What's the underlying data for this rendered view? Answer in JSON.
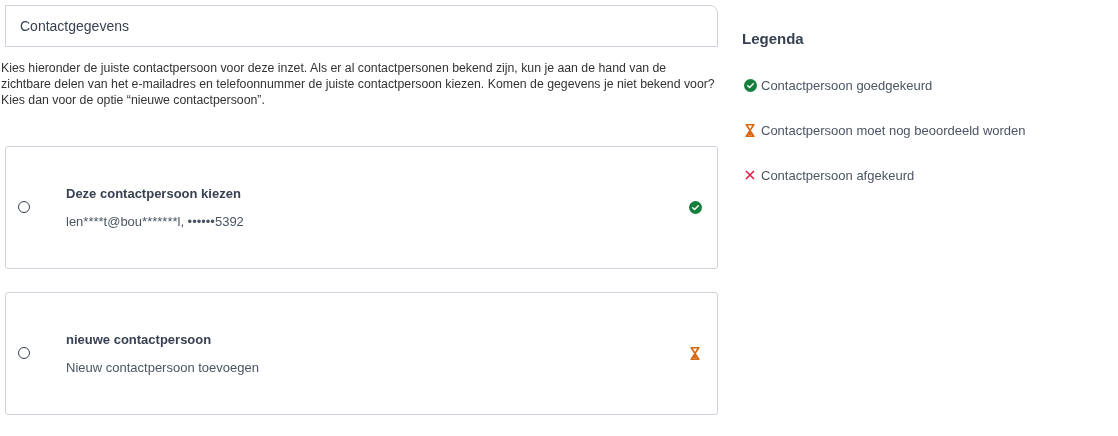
{
  "header": {
    "title": "Contactgegevens"
  },
  "intro": "Kies hieronder de juiste contactpersoon voor deze inzet. Als er al contactpersonen bekend zijn, kun je aan de hand van de zichtbare delen van het e-mailadres en telefoonnummer de juiste contactpersoon kiezen. Komen de gegevens je niet bekend voor? Kies dan voor de optie “nieuwe contactpersoon”.",
  "options": [
    {
      "title": "Deze contactpersoon kiezen",
      "detail": "len****t@bou*******l, ••••••5392",
      "selected": false,
      "kind": "approved"
    },
    {
      "title": "nieuwe contactpersoon",
      "detail": "Nieuw contactpersoon toevoegen",
      "selected": false,
      "kind": "pending"
    }
  ],
  "legend": {
    "title": "Legenda",
    "items": [
      {
        "kind": "approved",
        "label": "Contactpersoon goedgekeurd"
      },
      {
        "kind": "pending",
        "label": "Contactpersoon moet nog beoordeeld worden"
      },
      {
        "kind": "rejected",
        "label": "Contactpersoon afgekeurd"
      }
    ]
  }
}
